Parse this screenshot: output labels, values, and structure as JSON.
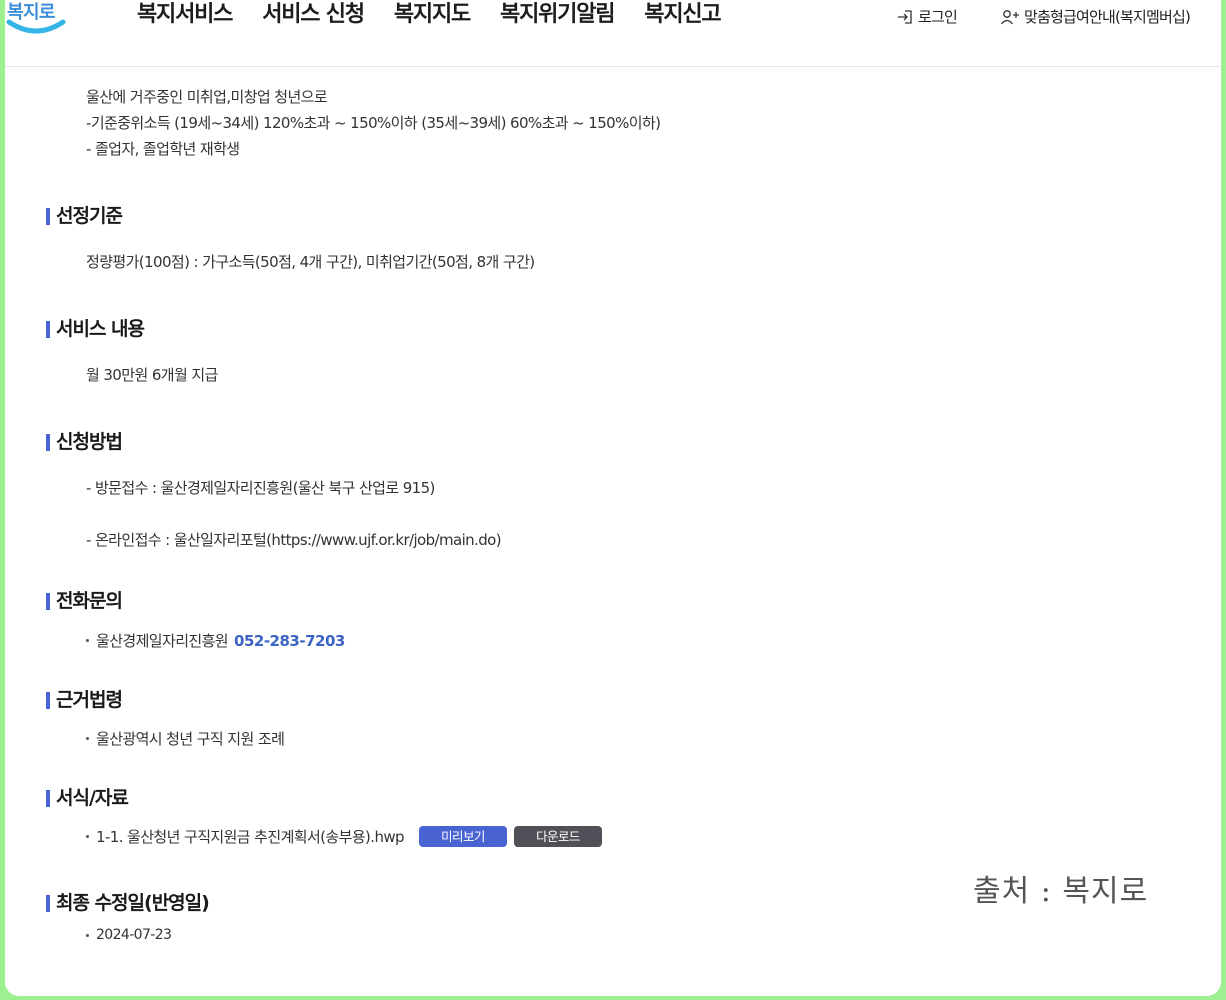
{
  "nav": {
    "items": [
      "복지서비스",
      "서비스 신청",
      "복지지도",
      "복지위기알림",
      "복지신고"
    ],
    "login": "로그인",
    "custom_guide": "맞춤형급여안내(복지멤버십)"
  },
  "eligibility": {
    "lines": [
      "울산에 거주중인 미취업,미창업 청년으로",
      "-기준중위소득 (19세~34세) 120%초과 ~ 150%이하 (35세~39세) 60%초과 ~ 150%이하)",
      "- 졸업자, 졸업학년 재학생"
    ]
  },
  "selection": {
    "title": "선정기준",
    "text": "정량평가(100점) : 가구소득(50점, 4개 구간), 미취업기간(50점, 8개 구간)"
  },
  "service": {
    "title": "서비스 내용",
    "text": "월 30만원 6개월 지급"
  },
  "apply": {
    "title": "신청방법",
    "visit": "- 방문접수 : 울산경제일자리진흥원(울산 북구 산업로 915)",
    "online": "- 온라인접수 : 울산일자리포털(https://www.ujf.or.kr/job/main.do)"
  },
  "contact": {
    "title": "전화문의",
    "org": "울산경제일자리진흥원",
    "phone": "052-283-7203"
  },
  "law": {
    "title": "근거법령",
    "item": "울산광역시 청년 구직 지원 조례"
  },
  "forms": {
    "title": "서식/자료",
    "file": "1-1. 울산청년 구직지원금 추진계획서(송부용).hwp",
    "preview_label": "미리보기",
    "download_label": "다운로드"
  },
  "updated": {
    "title": "최종 수정일(반영일)",
    "date": "2024-07-23"
  },
  "watermark": "출처 : 복지로",
  "colors": {
    "accent": "#4a66d6",
    "phone": "#3b63c4",
    "download_btn": "#505158",
    "frame_border": "#9cf08f"
  }
}
